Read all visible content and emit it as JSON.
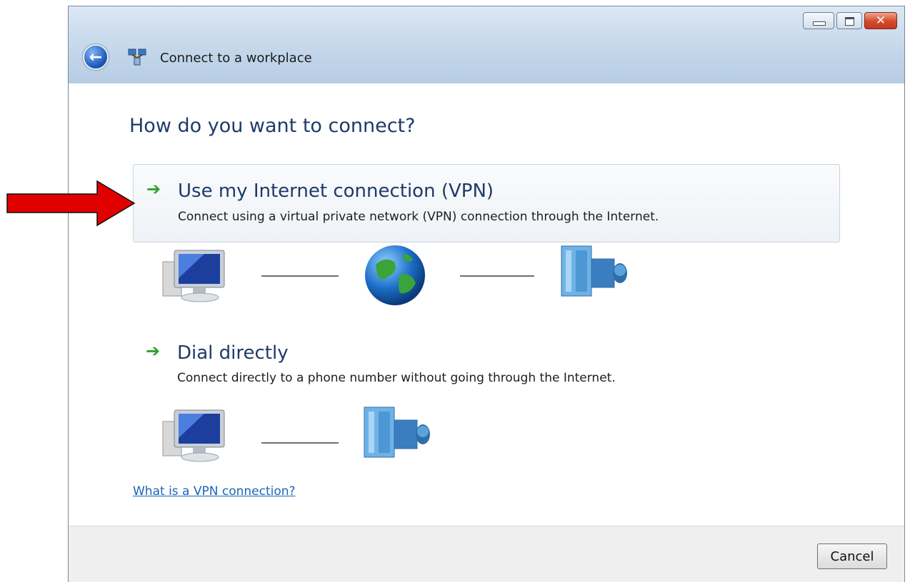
{
  "window": {
    "title": "Connect to a workplace",
    "controls": [
      "minimize-icon",
      "maximize-icon",
      "close-icon"
    ]
  },
  "page": {
    "heading": "How do you want to connect?"
  },
  "options": [
    {
      "title": "Use my Internet connection (VPN)",
      "description": "Connect using a virtual private network (VPN) connection through the Internet.",
      "icon": "green-arrow-icon",
      "diagram": [
        "computer-icon",
        "globe-icon",
        "server-icon"
      ],
      "highlighted": true
    },
    {
      "title": "Dial directly",
      "description": "Connect directly to a phone number without going through the Internet.",
      "icon": "green-arrow-icon",
      "diagram": [
        "computer-icon",
        "server-icon"
      ],
      "highlighted": false
    }
  ],
  "help_link": "What is a VPN connection?",
  "footer": {
    "cancel_label": "Cancel"
  },
  "annotation": {
    "icon": "red-arrow-icon",
    "color": "#e00000"
  },
  "colors": {
    "heading": "#1f3a6a",
    "link": "#1a66b8",
    "option_arrow": "#2fa02f"
  }
}
